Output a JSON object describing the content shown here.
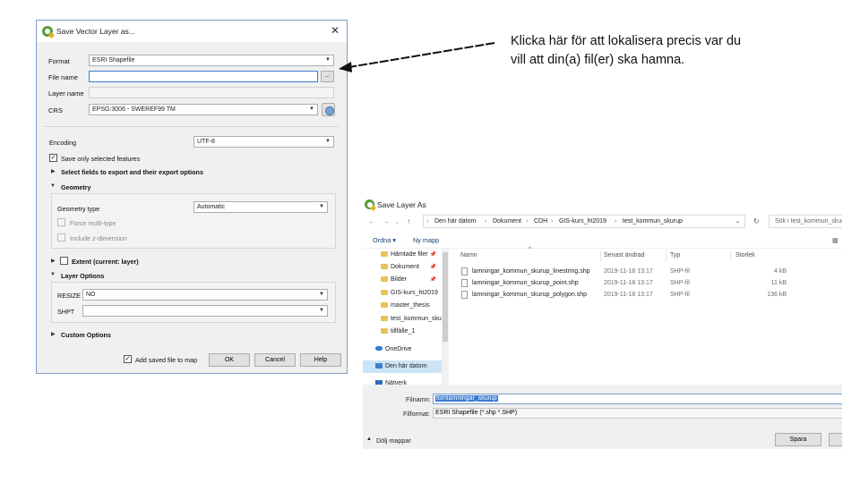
{
  "vector_dialog": {
    "title": "Save Vector Layer as...",
    "close_glyph": "✕",
    "format_label": "Format",
    "format_value": "ESRI Shapefile",
    "filename_label": "File name",
    "browse_label": "...",
    "layername_label": "Layer name",
    "crs_label": "CRS",
    "crs_value": "EPSG:3006 - SWEREF99 TM",
    "encoding_label": "Encoding",
    "encoding_value": "UTF-8",
    "save_selected_label": "Save only selected features",
    "select_fields_label": "Select fields to export and their export options",
    "geometry_label": "Geometry",
    "geometry_type_label": "Geometry type",
    "geometry_type_value": "Automatic",
    "force_multi_label": "Force multi-type",
    "include_z_label": "Include z-dimension",
    "extent_label": "Extent (current: layer)",
    "layer_options_label": "Layer Options",
    "resize_label": "RESIZE",
    "resize_value": "NO",
    "shpt_label": "SHPT",
    "custom_options_label": "Custom Options",
    "add_to_map_label": "Add saved file to map",
    "ok_label": "OK",
    "cancel_label": "Cancel",
    "help_label": "Help",
    "check_glyph": "✓"
  },
  "annotation": {
    "text": "Klicka här för att lokalisera precis var du vill att din(a) fil(er) ska hamna."
  },
  "file_dialog": {
    "title": "Save Layer As",
    "back_glyph": "←",
    "forward_glyph": "→",
    "up_glyph": "↑",
    "breadcrumbs": [
      "Den här datorn",
      "Dokument",
      "CDH",
      "GIS-kurs_ht2019",
      "test_kommun_skurup"
    ],
    "search_placeholder": "Sök i test_kommun_skurup",
    "organize_label": "Ordna ▾",
    "new_folder_label": "Ny mapp",
    "nav_items": [
      {
        "label": "Hämtade filer",
        "icon": "folder-icon"
      },
      {
        "label": "Dokument",
        "icon": "folder-icon"
      },
      {
        "label": "Bilder",
        "icon": "folder-icon"
      },
      {
        "label": "GIS-kurs_ht2019",
        "icon": "folder-icon"
      },
      {
        "label": "master_thesis",
        "icon": "folder-icon"
      },
      {
        "label": "test_kommun_skurup",
        "icon": "folder-icon"
      },
      {
        "label": "tillfälle_1",
        "icon": "folder-icon"
      },
      {
        "label": "OneDrive",
        "icon": "onedrive-icon"
      },
      {
        "label": "Den här datorn",
        "icon": "computer-icon"
      },
      {
        "label": "Nätverk",
        "icon": "network-icon"
      }
    ],
    "columns": [
      "Namn",
      "Senast ändrad",
      "Typ",
      "Storlek"
    ],
    "files": [
      {
        "name": "lamningar_kommun_skurup_linestring.shp",
        "modified": "2019-11-18 13:17",
        "type": "SHP-fil",
        "size": "4 kB"
      },
      {
        "name": "lamningar_kommun_skurup_point.shp",
        "modified": "2019-11-18 13:17",
        "type": "SHP-fil",
        "size": "11 kB"
      },
      {
        "name": "lamningar_kommun_skurup_polygon.shp",
        "modified": "2019-11-18 13:17",
        "type": "SHP-fil",
        "size": "136 kB"
      }
    ],
    "filename_label": "Filnamn:",
    "filename_value": "fornlamningar_skurup",
    "filetype_label": "Filformat:",
    "filetype_value": "ESRI Shapefile (*.shp *.SHP)",
    "hide_folders_label": "Dölj mappar",
    "save_label": "Spara"
  }
}
